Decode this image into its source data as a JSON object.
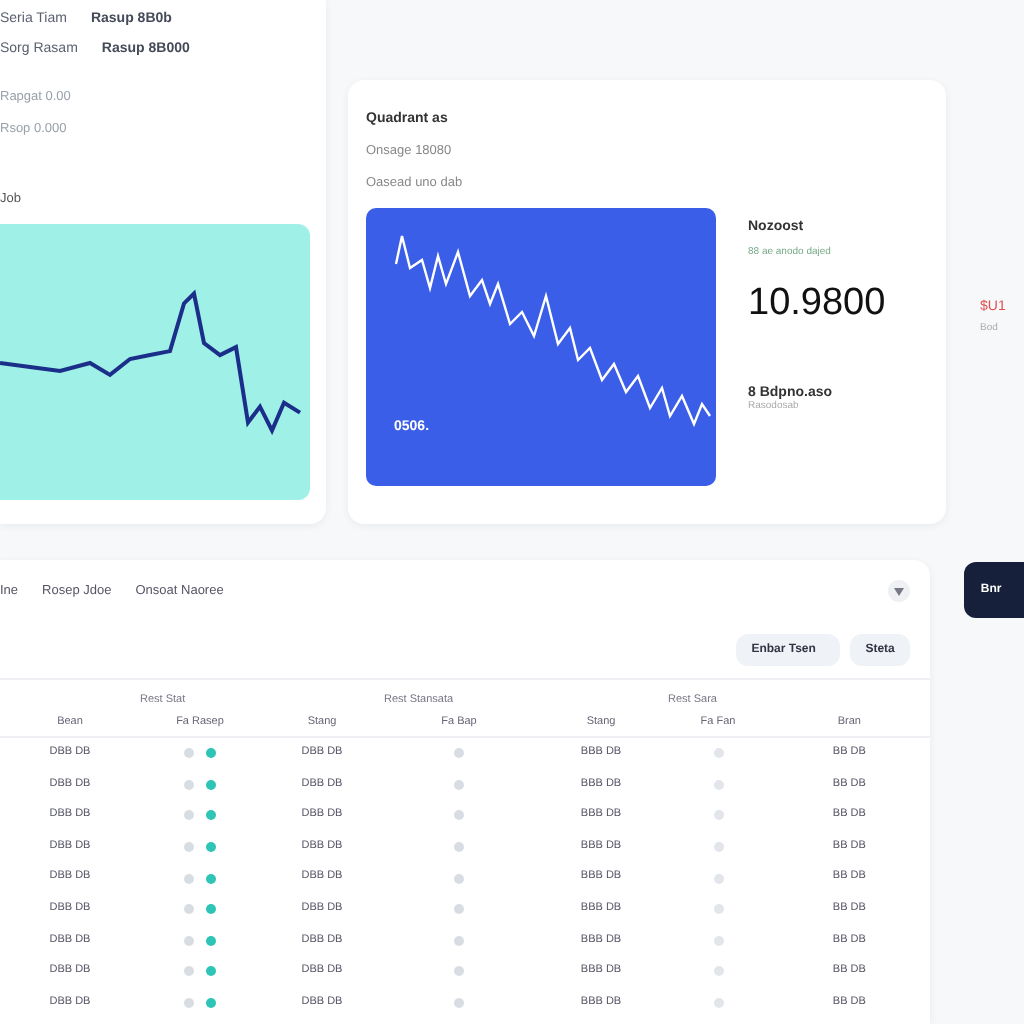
{
  "summary": {
    "lines": [
      {
        "label": "Seria Tiam",
        "value": "Rasup 8B0b"
      },
      {
        "label": "Sorg Rasam",
        "value": "Rasup 8B000"
      }
    ],
    "notes": [
      "Rapgat 0.00",
      "Rsop 0.000"
    ],
    "caption": "Job"
  },
  "overview": {
    "title": "Quadrant as",
    "lines": [
      "Onsage 18080",
      "Oasead uno dab"
    ],
    "chart_label": "0506.",
    "stat": {
      "title": "Nozoost",
      "change": "88 ae anodo dajed",
      "value": "10.9800",
      "footer": "8 Bdpno.aso",
      "footer_note": "Rasodosab"
    }
  },
  "side": {
    "change": "$U1",
    "note": "Bod",
    "button": "Bnr"
  },
  "table": {
    "tabs": [
      "Ine",
      "Rosep Jdoe",
      "Onsoat Naoree"
    ],
    "search": "Enbar Tsen",
    "button": "Steta",
    "groups": [
      "Rest Stat",
      "Rest Stansata",
      "Rest Sara"
    ],
    "columns": [
      "Bean",
      "Fa Rasep",
      "Stang",
      "Fa Bap",
      "Stang",
      "Fa Fan",
      "Bran"
    ],
    "rows": [
      {
        "values": [
          "DBB DB",
          "DBB DB",
          "BBB DB",
          "BB DB"
        ],
        "color": "#2ec4b6"
      },
      {
        "values": [
          "DBB DB",
          "DBB DB",
          "BBB DB",
          "BB DB"
        ],
        "color": "#2ec4b6"
      },
      {
        "values": [
          "DBB DB",
          "DBB DB",
          "BBB DB",
          "BB DB"
        ],
        "color": "#2ec4b6"
      },
      {
        "values": [
          "DBB DB",
          "DBB DB",
          "BBB DB",
          "BB DB"
        ],
        "color": "#2ec4b6"
      },
      {
        "values": [
          "DBB DB",
          "DBB DB",
          "BBB DB",
          "BB DB"
        ],
        "color": "#2ec4b6"
      },
      {
        "values": [
          "DBB DB",
          "DBB DB",
          "BBB DB",
          "BB DB"
        ],
        "color": "#2ec4b6"
      },
      {
        "values": [
          "DBB DB",
          "DBB DB",
          "BBB DB",
          "BB DB"
        ],
        "color": "#2ec4b6"
      },
      {
        "values": [
          "DBB DB",
          "DBB DB",
          "BBB DB",
          "BB DB"
        ],
        "color": "#2ec4b6"
      },
      {
        "values": [
          "DBB DB",
          "DBB DB",
          "BBB DB",
          "BB DB"
        ],
        "color": "#2ec4b6"
      }
    ]
  }
}
